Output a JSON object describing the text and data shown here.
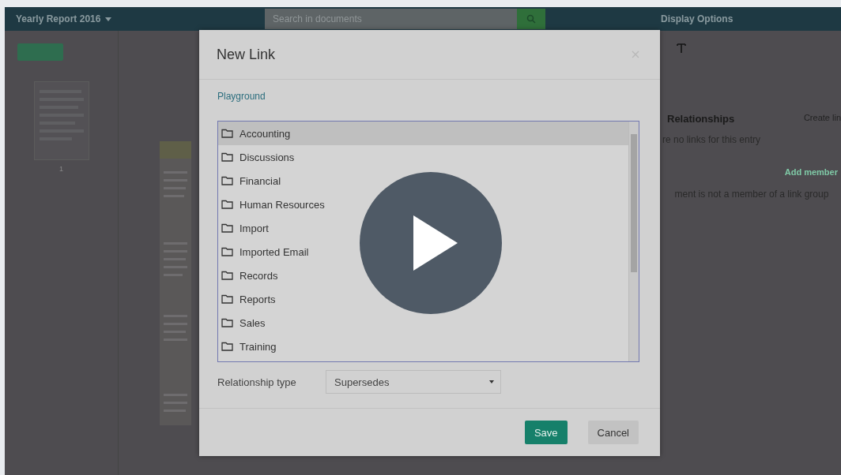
{
  "app": {
    "title": "Yearly Report 2016",
    "search": {
      "placeholder": "Search in documents"
    },
    "menu": [
      "Display Options"
    ]
  },
  "thumbnail": {
    "page": "1"
  },
  "side_panel": {
    "heading": "Relationships",
    "action": "Create lin",
    "empty_text": "re no links for this entry",
    "group_action": "Add member",
    "group_text": "ment is not a member of a link group"
  },
  "dialog": {
    "title": "New Link",
    "breadcrumb": "Playground",
    "folders": [
      {
        "name": "Accounting",
        "selected": true
      },
      {
        "name": "Discussions",
        "selected": false
      },
      {
        "name": "Financial",
        "selected": false
      },
      {
        "name": "Human Resources",
        "selected": false
      },
      {
        "name": "Import",
        "selected": false
      },
      {
        "name": "Imported Email",
        "selected": false
      },
      {
        "name": "Records",
        "selected": false
      },
      {
        "name": "Reports",
        "selected": false
      },
      {
        "name": "Sales",
        "selected": false
      },
      {
        "name": "Training",
        "selected": false
      }
    ],
    "relationship_type": {
      "label": "Relationship type",
      "value": "Supersedes"
    },
    "buttons": [
      {
        "label": "Save",
        "kind": "primary"
      },
      {
        "label": "Cancel",
        "kind": "secondary"
      }
    ]
  }
}
